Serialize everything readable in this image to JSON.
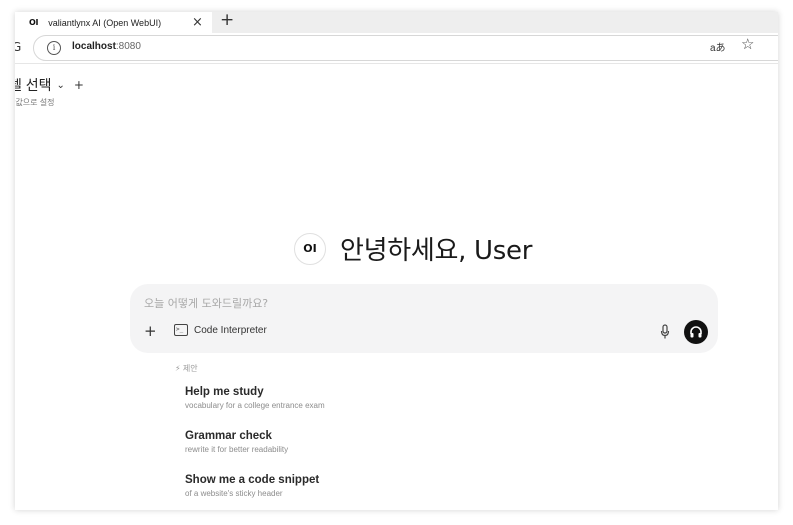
{
  "browser": {
    "tab": {
      "favicon": "OI",
      "title": "valiantlynx AI (Open WebUI)",
      "close": "×"
    },
    "new_tab": "+",
    "back_glyph": "G",
    "url_host": "localhost",
    "url_port": ":8080",
    "translate_label": "aあ",
    "star": "☆"
  },
  "header": {
    "model_select": "델 선택",
    "chevron": "⌄",
    "add": "+",
    "default_set": "?값으로 설정"
  },
  "greeting": {
    "logo": "OI",
    "text": "안녕하세요, User"
  },
  "chat": {
    "placeholder": "오늘 어떻게 도와드릴까요?",
    "attach": "+",
    "code_interpreter": "Code Interpreter"
  },
  "suggestions": {
    "header": "⚡ 제안",
    "items": [
      {
        "title": "Help me study",
        "subtitle": "vocabulary for a college entrance exam"
      },
      {
        "title": "Grammar check",
        "subtitle": "rewrite it for better readability"
      },
      {
        "title": "Show me a code snippet",
        "subtitle": "of a website's sticky header"
      }
    ]
  },
  "icons": {
    "info": "info-icon",
    "translate": "translate-icon",
    "star": "star-icon",
    "mic": "microphone-icon",
    "voice": "headphones-icon",
    "terminal": "terminal-icon"
  }
}
